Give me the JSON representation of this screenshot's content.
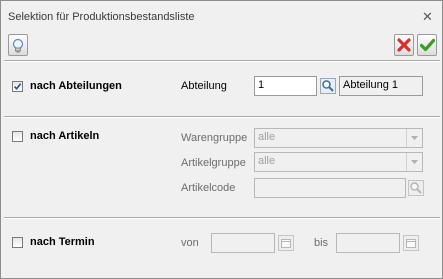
{
  "window": {
    "title": "Selektion für Produktionsbestandsliste"
  },
  "toolbar": {
    "hint_icon": "lightbulb-icon",
    "cancel_icon": "red-x-icon",
    "ok_icon": "green-check-icon"
  },
  "sections": {
    "abteilungen": {
      "label": "nach Abteilungen",
      "checked": true,
      "field_label": "Abteilung",
      "field_value": "1",
      "result_value": "Abteilung 1"
    },
    "artikeln": {
      "label": "nach Artikeln",
      "checked": false,
      "warengruppe_label": "Warengruppe",
      "warengruppe_value": "alle",
      "artikelgruppe_label": "Artikelgruppe",
      "artikelgruppe_value": "alle",
      "artikelcode_label": "Artikelcode",
      "artikelcode_value": ""
    },
    "termin": {
      "label": "nach Termin",
      "checked": false,
      "von_label": "von",
      "von_value": "",
      "bis_label": "bis",
      "bis_value": ""
    }
  },
  "colors": {
    "cancel": "#d9302b",
    "ok": "#3f9a28",
    "check": "#1d4fa3"
  }
}
